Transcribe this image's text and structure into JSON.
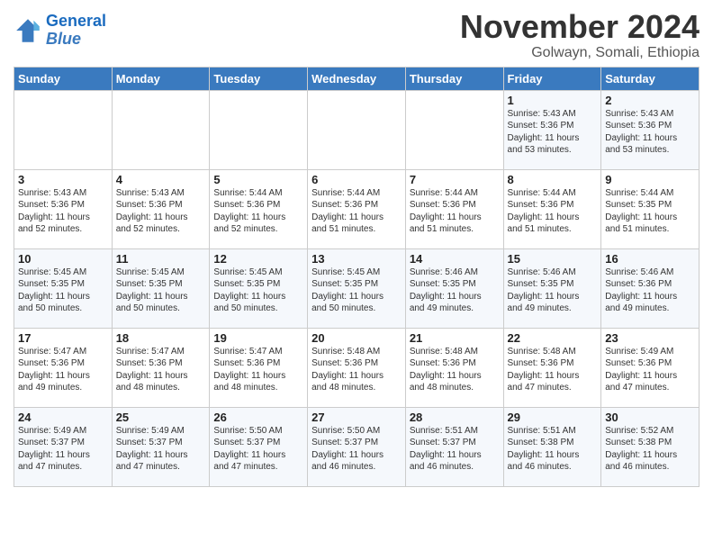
{
  "header": {
    "logo_line1": "General",
    "logo_line2": "Blue",
    "main_title": "November 2024",
    "subtitle": "Golwayn, Somali, Ethiopia"
  },
  "weekdays": [
    "Sunday",
    "Monday",
    "Tuesday",
    "Wednesday",
    "Thursday",
    "Friday",
    "Saturday"
  ],
  "weeks": [
    [
      {
        "day": "",
        "info": ""
      },
      {
        "day": "",
        "info": ""
      },
      {
        "day": "",
        "info": ""
      },
      {
        "day": "",
        "info": ""
      },
      {
        "day": "",
        "info": ""
      },
      {
        "day": "1",
        "info": "Sunrise: 5:43 AM\nSunset: 5:36 PM\nDaylight: 11 hours\nand 53 minutes."
      },
      {
        "day": "2",
        "info": "Sunrise: 5:43 AM\nSunset: 5:36 PM\nDaylight: 11 hours\nand 53 minutes."
      }
    ],
    [
      {
        "day": "3",
        "info": "Sunrise: 5:43 AM\nSunset: 5:36 PM\nDaylight: 11 hours\nand 52 minutes."
      },
      {
        "day": "4",
        "info": "Sunrise: 5:43 AM\nSunset: 5:36 PM\nDaylight: 11 hours\nand 52 minutes."
      },
      {
        "day": "5",
        "info": "Sunrise: 5:44 AM\nSunset: 5:36 PM\nDaylight: 11 hours\nand 52 minutes."
      },
      {
        "day": "6",
        "info": "Sunrise: 5:44 AM\nSunset: 5:36 PM\nDaylight: 11 hours\nand 51 minutes."
      },
      {
        "day": "7",
        "info": "Sunrise: 5:44 AM\nSunset: 5:36 PM\nDaylight: 11 hours\nand 51 minutes."
      },
      {
        "day": "8",
        "info": "Sunrise: 5:44 AM\nSunset: 5:36 PM\nDaylight: 11 hours\nand 51 minutes."
      },
      {
        "day": "9",
        "info": "Sunrise: 5:44 AM\nSunset: 5:35 PM\nDaylight: 11 hours\nand 51 minutes."
      }
    ],
    [
      {
        "day": "10",
        "info": "Sunrise: 5:45 AM\nSunset: 5:35 PM\nDaylight: 11 hours\nand 50 minutes."
      },
      {
        "day": "11",
        "info": "Sunrise: 5:45 AM\nSunset: 5:35 PM\nDaylight: 11 hours\nand 50 minutes."
      },
      {
        "day": "12",
        "info": "Sunrise: 5:45 AM\nSunset: 5:35 PM\nDaylight: 11 hours\nand 50 minutes."
      },
      {
        "day": "13",
        "info": "Sunrise: 5:45 AM\nSunset: 5:35 PM\nDaylight: 11 hours\nand 50 minutes."
      },
      {
        "day": "14",
        "info": "Sunrise: 5:46 AM\nSunset: 5:35 PM\nDaylight: 11 hours\nand 49 minutes."
      },
      {
        "day": "15",
        "info": "Sunrise: 5:46 AM\nSunset: 5:35 PM\nDaylight: 11 hours\nand 49 minutes."
      },
      {
        "day": "16",
        "info": "Sunrise: 5:46 AM\nSunset: 5:36 PM\nDaylight: 11 hours\nand 49 minutes."
      }
    ],
    [
      {
        "day": "17",
        "info": "Sunrise: 5:47 AM\nSunset: 5:36 PM\nDaylight: 11 hours\nand 49 minutes."
      },
      {
        "day": "18",
        "info": "Sunrise: 5:47 AM\nSunset: 5:36 PM\nDaylight: 11 hours\nand 48 minutes."
      },
      {
        "day": "19",
        "info": "Sunrise: 5:47 AM\nSunset: 5:36 PM\nDaylight: 11 hours\nand 48 minutes."
      },
      {
        "day": "20",
        "info": "Sunrise: 5:48 AM\nSunset: 5:36 PM\nDaylight: 11 hours\nand 48 minutes."
      },
      {
        "day": "21",
        "info": "Sunrise: 5:48 AM\nSunset: 5:36 PM\nDaylight: 11 hours\nand 48 minutes."
      },
      {
        "day": "22",
        "info": "Sunrise: 5:48 AM\nSunset: 5:36 PM\nDaylight: 11 hours\nand 47 minutes."
      },
      {
        "day": "23",
        "info": "Sunrise: 5:49 AM\nSunset: 5:36 PM\nDaylight: 11 hours\nand 47 minutes."
      }
    ],
    [
      {
        "day": "24",
        "info": "Sunrise: 5:49 AM\nSunset: 5:37 PM\nDaylight: 11 hours\nand 47 minutes."
      },
      {
        "day": "25",
        "info": "Sunrise: 5:49 AM\nSunset: 5:37 PM\nDaylight: 11 hours\nand 47 minutes."
      },
      {
        "day": "26",
        "info": "Sunrise: 5:50 AM\nSunset: 5:37 PM\nDaylight: 11 hours\nand 47 minutes."
      },
      {
        "day": "27",
        "info": "Sunrise: 5:50 AM\nSunset: 5:37 PM\nDaylight: 11 hours\nand 46 minutes."
      },
      {
        "day": "28",
        "info": "Sunrise: 5:51 AM\nSunset: 5:37 PM\nDaylight: 11 hours\nand 46 minutes."
      },
      {
        "day": "29",
        "info": "Sunrise: 5:51 AM\nSunset: 5:38 PM\nDaylight: 11 hours\nand 46 minutes."
      },
      {
        "day": "30",
        "info": "Sunrise: 5:52 AM\nSunset: 5:38 PM\nDaylight: 11 hours\nand 46 minutes."
      }
    ]
  ]
}
